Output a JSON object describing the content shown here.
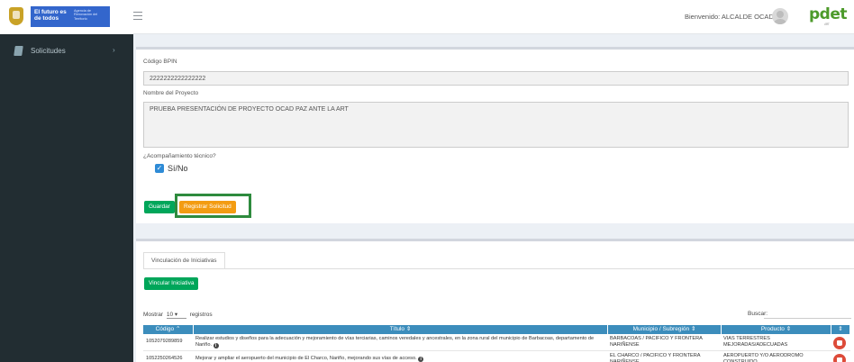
{
  "header": {
    "brand_line1": "El futuro es de todos",
    "brand_line2": "Agencia de Renovación del Territorio",
    "welcome": "Bienvenido: ALCALDE OCAD",
    "logo_text": "pdet",
    "logo_sub": "ART",
    "accent_color": "#3366cc"
  },
  "sidebar": {
    "items": [
      {
        "label": "Solicitudes",
        "icon": "file-icon"
      }
    ]
  },
  "form": {
    "bpin_label": "Código BPIN",
    "bpin_value": "2222222222222222",
    "project_label": "Nombre del Proyecto",
    "project_value": "PRUEBA PRESENTACIÓN DE PROYECTO OCAD PAZ ANTE LA ART",
    "accomp_label": "¿Acompañamiento técnico?",
    "checkbox_label": "Sí/No",
    "checkbox_checked": true,
    "save_label": "Guardar",
    "register_label": "Registrar Solicitud"
  },
  "initiatives": {
    "tab_label": "Vinculación de Iniciativas",
    "link_button": "Vincular Iniciativa",
    "length_prefix": "Mostrar",
    "length_value": "10",
    "length_suffix": "registros",
    "search_label": "Buscar:",
    "columns": [
      "Código",
      "Título",
      "Municipio / Subregión",
      "Producto"
    ],
    "rows": [
      {
        "codigo": "1052079289859",
        "titulo": "Realizar estudios y diseños para la adecuación y mejoramiento de vías terciarias, caminos veredales y ancestrales, en la zona rural del municipio de Barbacoas, departamento de Nariño.",
        "municipio": "BARBACOAS / PACÍFICO Y FRONTERA NARIÑENSE",
        "producto": "VÍAS TERRESTRES MEJORADAS/ADECUADAS"
      },
      {
        "codigo": "1052250264526",
        "titulo": "Mejorar y ampliar el aeropuerto del municipio de El Charco, Nariño, mejorando sus vías de acceso.",
        "municipio": "EL CHARCO / PACÍFICO Y FRONTERA NARIÑENSE",
        "producto": "AEROPUERTO Y/O AERÓDROMO CONSTRUIDO"
      }
    ]
  }
}
